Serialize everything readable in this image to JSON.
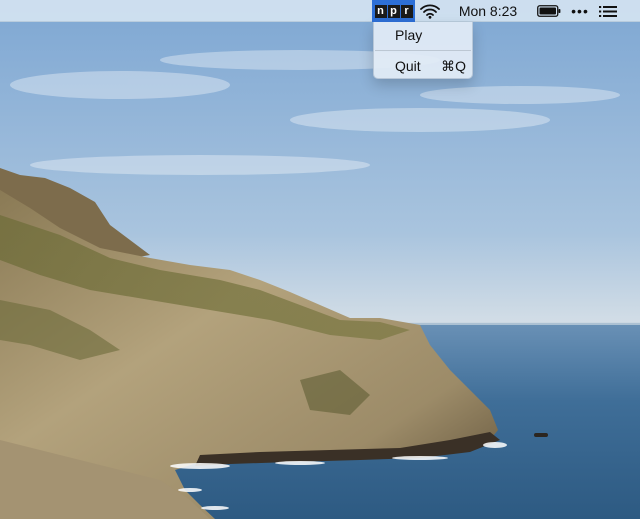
{
  "menubar": {
    "app_icon": "npr-icon",
    "npr_letters": [
      "n",
      "p",
      "r"
    ],
    "wifi_icon": "wifi-icon",
    "clock": "Mon 8:23",
    "battery_icon": "battery-icon",
    "more_icon": "more-dots-icon",
    "more_text": "•••",
    "list_icon": "control-list-icon"
  },
  "dropdown": {
    "items": [
      {
        "label": "Play",
        "shortcut": ""
      },
      {
        "label": "Quit",
        "shortcut": "⌘Q"
      }
    ]
  },
  "colors": {
    "npr_highlight": "#2d6fd6",
    "menubar_bg": "#dfeaf4",
    "sky": "#8fb6d8",
    "sea": "#3d6c95"
  }
}
